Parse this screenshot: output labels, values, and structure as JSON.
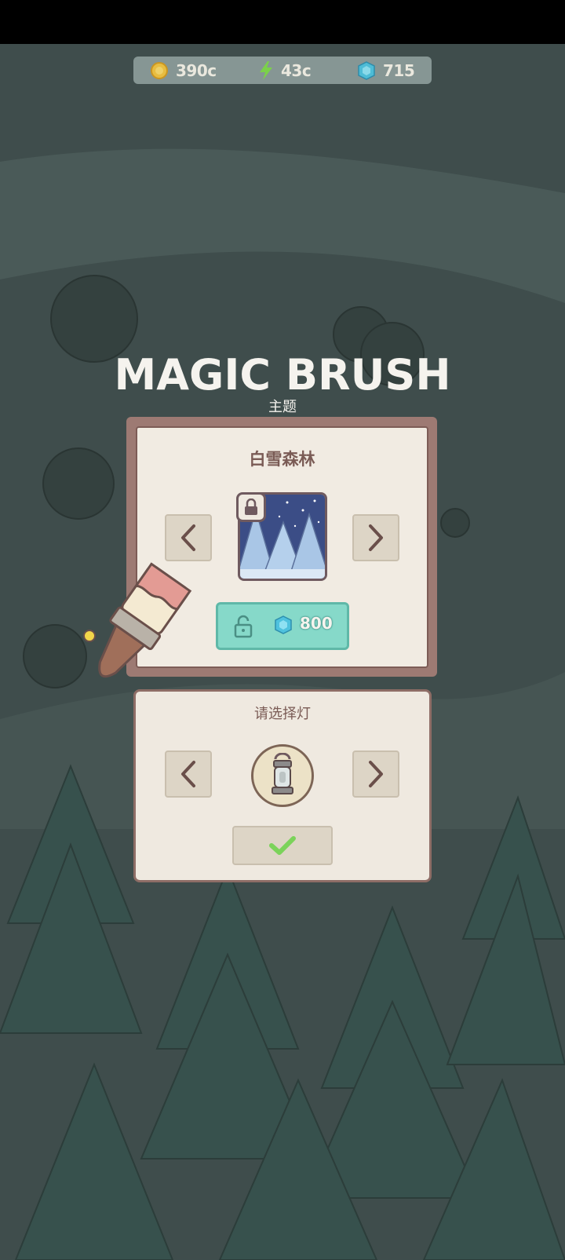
{
  "currency": {
    "coins": "390c",
    "energy": "43c",
    "gems": "715"
  },
  "title": "MAGIC BRUSH",
  "subtitle": "主题",
  "theme_panel": {
    "title": "白雪森林",
    "price": "800"
  },
  "lamp_panel": {
    "title": "请选择灯"
  },
  "colors": {
    "coin": "#f2c341",
    "energy": "#7fd94a",
    "gem": "#4fc2de",
    "buy_button": "#86d9c9",
    "confirm_check": "#7bd35a"
  }
}
